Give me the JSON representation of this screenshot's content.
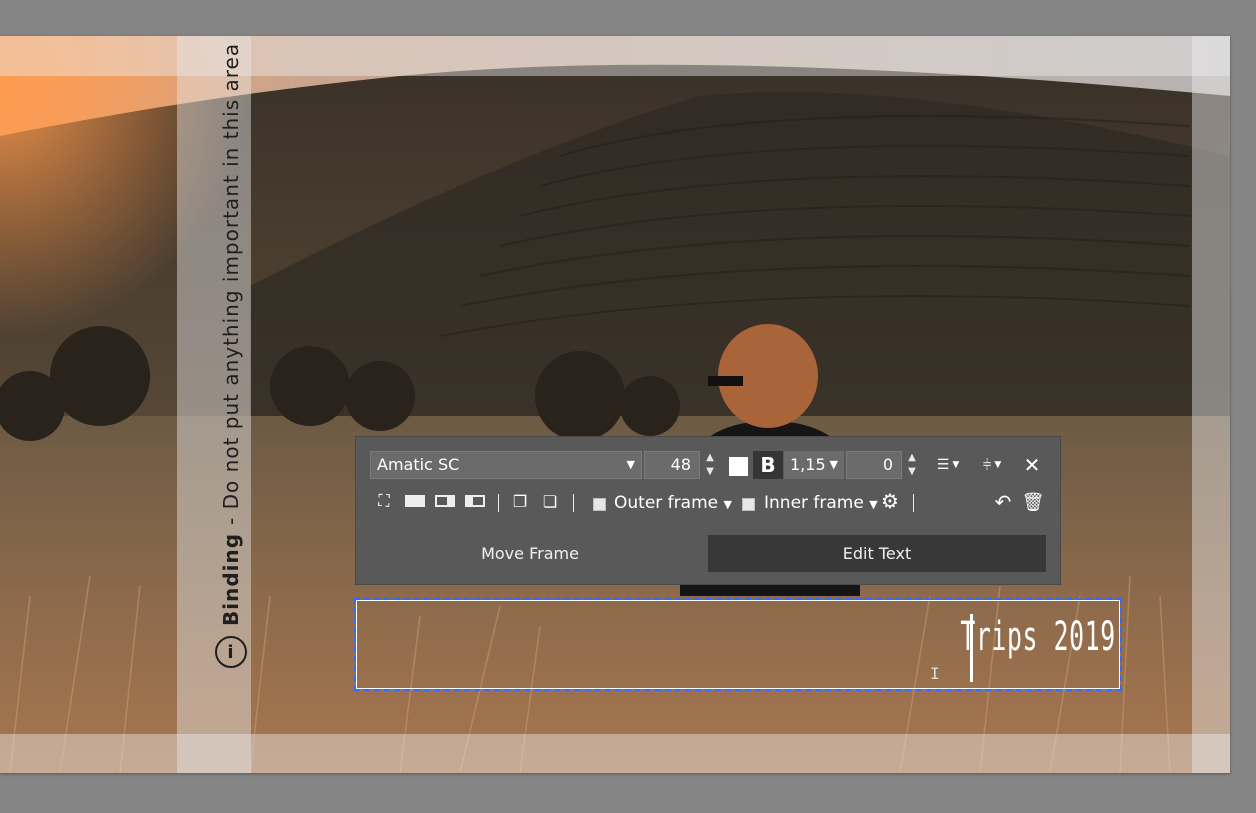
{
  "binding_note": {
    "bold": "Binding",
    "text": "- Do not put anything important in this area"
  },
  "toolbar": {
    "font_family": "Amatic SC",
    "font_size": "48",
    "line_spacing": "1,15",
    "letter_spacing": "0",
    "bold_label": "B",
    "outer_frame_label": "Outer frame",
    "inner_frame_label": "Inner frame",
    "tabs": [
      {
        "label": "Move Frame",
        "active": false
      },
      {
        "label": "Edit Text",
        "active": true
      }
    ]
  },
  "text_frame": {
    "content": "Trips 2019"
  },
  "colors": {
    "toolbar_bg": "#595959",
    "active_tab_bg": "#383838",
    "selection_border": "#2f6bff"
  }
}
